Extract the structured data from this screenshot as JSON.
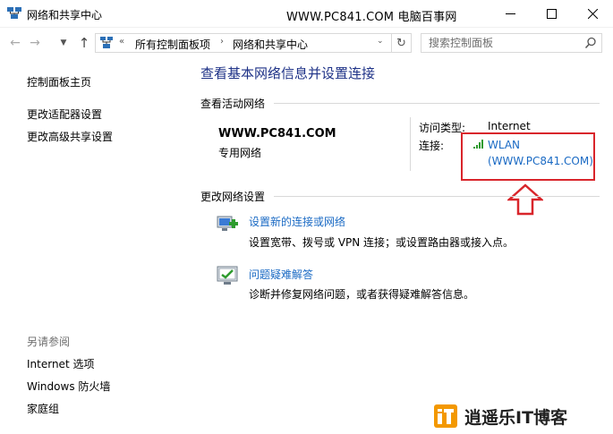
{
  "window": {
    "title": "网络和共享中心",
    "watermark": "WWW.PC841.COM 电脑百事网",
    "minimize_icon": "minimize-icon",
    "maximize_icon": "maximize-icon",
    "close_icon": "close-icon"
  },
  "address_bar": {
    "breadcrumb_prefix": "«",
    "crumbs": [
      "所有控制面板项",
      "网络和共享中心"
    ],
    "separator": "›",
    "search_placeholder": "搜索控制面板"
  },
  "left_pane": {
    "links": [
      "控制面板主页",
      "更改适配器设置",
      "更改高级共享设置"
    ],
    "see_also_title": "另请参阅",
    "see_also_links": [
      "Internet 选项",
      "Windows 防火墙",
      "家庭组"
    ]
  },
  "main": {
    "heading": "查看基本网络信息并设置连接",
    "active_section_title": "查看活动网络",
    "network": {
      "name": "WWW.PC841.COM",
      "type": "专用网络",
      "access_label": "访问类型:",
      "access_value": "Internet",
      "connection_label": "连接:",
      "connection_line1": "WLAN",
      "connection_line2": "(WWW.PC841.COM)"
    },
    "change_section_title": "更改网络设置",
    "tasks": [
      {
        "link": "设置新的连接或网络",
        "desc": "设置宽带、拨号或 VPN 连接；或设置路由器或接入点。",
        "icon": "new-connection-icon"
      },
      {
        "link": "问题疑难解答",
        "desc": "诊断并修复网络问题，或者获得疑难解答信息。",
        "icon": "troubleshoot-icon"
      }
    ]
  },
  "colors": {
    "heading": "#1e3287",
    "link": "#1a6ac4",
    "highlight": "#d9252b",
    "logo_orange": "#f39800"
  },
  "logo": {
    "text": "逍遥乐IT博客"
  }
}
